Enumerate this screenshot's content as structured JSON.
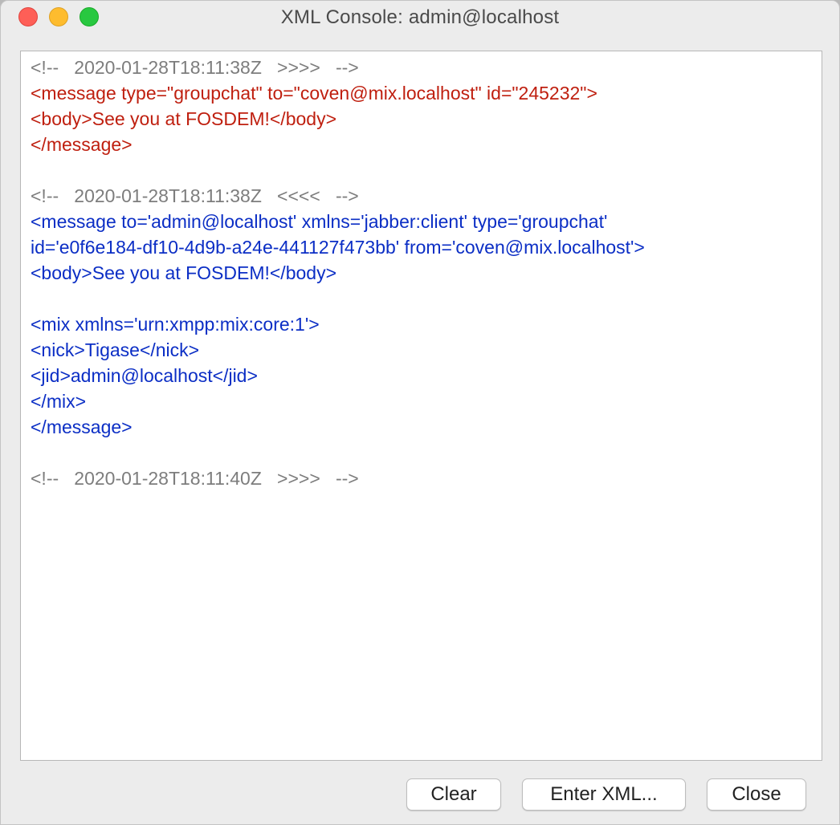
{
  "window": {
    "title": "XML Console: admin@localhost"
  },
  "colors": {
    "outgoing": "#bf1f0f",
    "incoming": "#0b2ec5",
    "comment": "#7d7d7d"
  },
  "log": {
    "entry1": {
      "comment": "<!--   2020-01-28T18:11:38Z   >>>>   -->",
      "lines": [
        "<message type=\"groupchat\" to=\"coven@mix.localhost\" id=\"245232\">",
        "<body>See you at FOSDEM!</body>",
        "</message>"
      ]
    },
    "entry2": {
      "comment": "<!--   2020-01-28T18:11:38Z   <<<<   -->",
      "lines": [
        "<message to='admin@localhost' xmlns='jabber:client' type='groupchat'",
        "id='e0f6e184-df10-4d9b-a24e-441127f473bb' from='coven@mix.localhost'>",
        "<body>See you at FOSDEM!</body>",
        "",
        "<mix xmlns='urn:xmpp:mix:core:1'>",
        "<nick>Tigase</nick>",
        "<jid>admin@localhost</jid>",
        "</mix>",
        "</message>"
      ]
    },
    "entry3": {
      "comment": "<!--   2020-01-28T18:11:40Z   >>>>   -->"
    }
  },
  "buttons": {
    "clear": "Clear",
    "enter_xml": "Enter XML...",
    "close": "Close"
  }
}
